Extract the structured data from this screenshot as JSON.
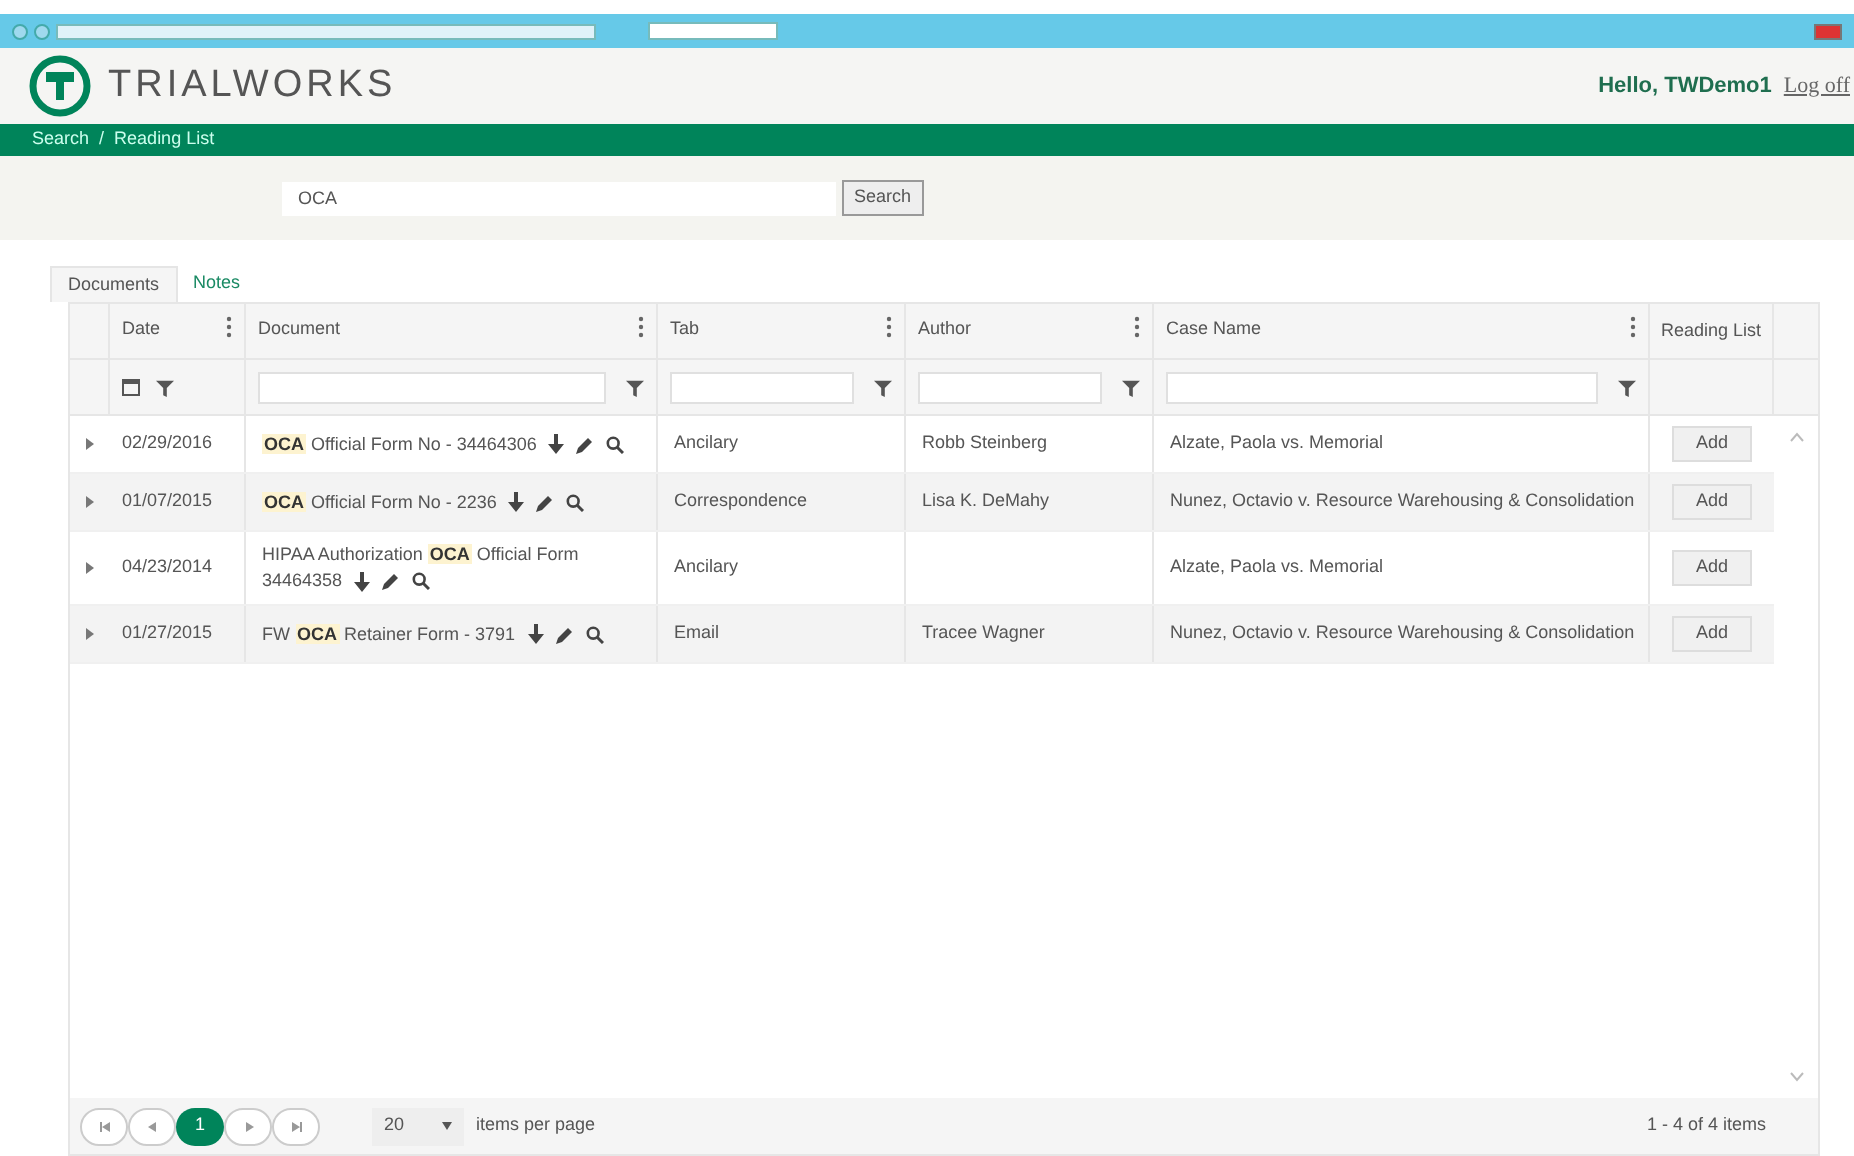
{
  "header": {
    "logo": "TRIALWORKS",
    "greeting": "Hello, TWDemo1",
    "logoff": "Log off"
  },
  "breadcrumb": [
    "Search",
    "Reading List"
  ],
  "breadcrumb_separator": "/",
  "search": {
    "value": "OCA",
    "button": "Search"
  },
  "tabs": [
    {
      "label": "Documents",
      "selected": true
    },
    {
      "label": "Notes",
      "selected": false
    }
  ],
  "table": {
    "columns": [
      "Date",
      "Document",
      "Tab",
      "Author",
      "Case Name",
      "Reading List"
    ],
    "rows": [
      {
        "date": "02/29/2016",
        "document": [
          {
            "text": "OCA",
            "highlight": true
          },
          {
            "text": " Official Form No - 34464306",
            "highlight": false
          }
        ],
        "tab": "Ancilary",
        "author": "Robb Steinberg",
        "case": "Alzate, Paola vs. Memorial",
        "action": "Add"
      },
      {
        "date": "01/07/2015",
        "document": [
          {
            "text": "OCA",
            "highlight": true
          },
          {
            "text": " Official Form No - 2236",
            "highlight": false
          }
        ],
        "tab": "Correspondence",
        "author": "Lisa K. DeMahy",
        "case": "Nunez, Octavio v. Resource Warehousing & Consolidation",
        "action": "Add"
      },
      {
        "date": "04/23/2014",
        "document": [
          {
            "text": "HIPAA Authorization ",
            "highlight": false
          },
          {
            "text": "OCA",
            "highlight": true
          },
          {
            "text": " Official Form 34464358",
            "highlight": false
          }
        ],
        "tab": "Ancilary",
        "author": "",
        "case": "Alzate, Paola vs. Memorial",
        "action": "Add"
      },
      {
        "date": "01/27/2015",
        "document": [
          {
            "text": "FW ",
            "highlight": false
          },
          {
            "text": "OCA",
            "highlight": true
          },
          {
            "text": " Retainer Form - 3791",
            "highlight": false
          }
        ],
        "tab": "Email",
        "author": "Tracee Wagner",
        "case": "Nunez, Octavio v. Resource Warehousing & Consolidation",
        "action": "Add"
      }
    ]
  },
  "pager": {
    "pages": [
      {
        "label": "1",
        "selected": true
      }
    ],
    "page_size": "20",
    "page_size_label": "items per page",
    "summary": "1 - 4 of 4 items"
  }
}
